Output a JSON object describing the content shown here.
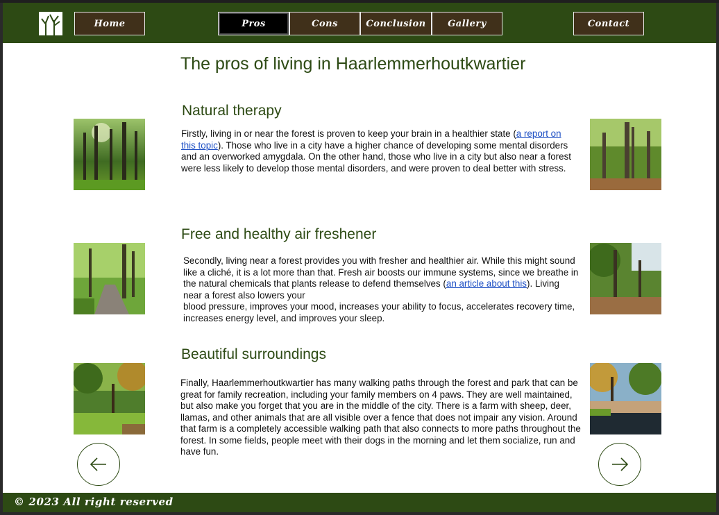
{
  "nav": {
    "home": "Home",
    "pros": "Pros",
    "cons": "Cons",
    "conclusion": "Conclusion",
    "gallery": "Gallery",
    "contact": "Contact"
  },
  "page": {
    "title": "The pros of living in Haarlemmerhoutkwartier"
  },
  "sections": [
    {
      "title": "Natural therapy",
      "text_before": "Firstly, living in or near the forest is proven to keep your brain in a healthier state (",
      "link": "a report on this topic",
      "text_after": "). Those who live in a city have a higher chance of developing some mental disorders and an overworked amygdala. On the other hand, those who live in a city but also near a forest were less likely to develop those mental disorders, and were proven to deal better with stress."
    },
    {
      "title": "Free and healthy air freshener",
      "text_before": "Secondly, living near a forest provides you with fresher and healthier air. While this might sound like a cliché, it is a lot more than that. Fresh air boosts our immune systems, since we breathe in the natural chemicals that plants release to defend themselves (",
      "link": "an article about this",
      "text_mid": "). Living near a forest also lowers your",
      "text_after": "blood pressure, improves your mood, increases your ability to focus, accelerates recovery time, increases energy level, and improves your sleep."
    },
    {
      "title": "Beautiful surroundings",
      "text": "Finally, Haarlemmerhoutkwartier has many walking paths through the forest and park that can be great for family recreation, including your family members on 4 paws. They are well maintained, but also make you forget that you are in the middle of the city. There is a farm with sheep, deer, llamas, and other animals that are all visible over a fence that does not impair any vision. Around that farm is a completely accessible walking path that also connects to more paths throughout the forest. In some fields, people meet with their dogs in the morning and let them socialize, run and have fun."
    }
  ],
  "icons": {
    "logo": "tree-logo-icon",
    "prev": "arrow-left-icon",
    "next": "arrow-right-icon"
  },
  "colors": {
    "brand_green": "#2d4a14",
    "nav_brown": "#40301a",
    "link_blue": "#1d4fc4"
  },
  "footer": {
    "text": "© 2023 All right reserved"
  }
}
